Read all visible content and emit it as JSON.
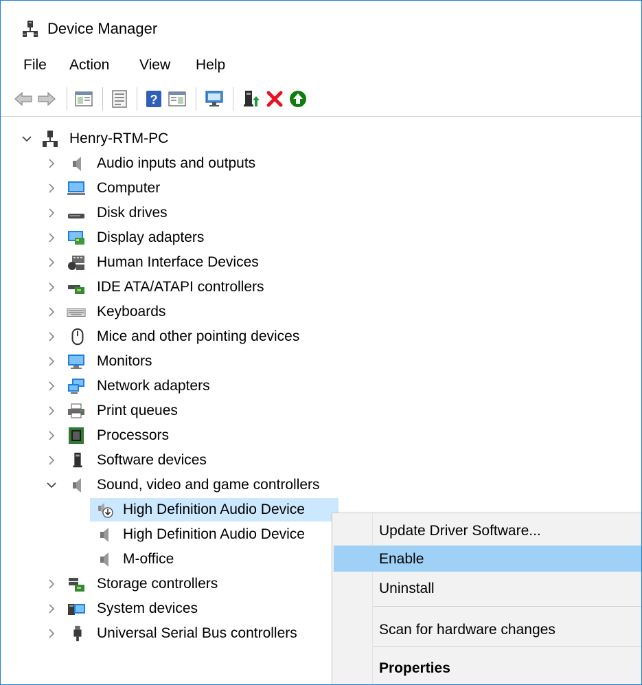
{
  "window": {
    "title": "Device Manager",
    "app_icon": "device-manager-icon"
  },
  "menubar": [
    "File",
    "Action",
    "View",
    "Help"
  ],
  "toolbar": [
    {
      "name": "back-arrow-icon",
      "enabled": false
    },
    {
      "name": "forward-arrow-icon",
      "enabled": false
    },
    {
      "name": "show-hide-console-tree-icon"
    },
    {
      "name": "properties-icon"
    },
    {
      "name": "help-icon"
    },
    {
      "name": "show-action-pane-icon"
    },
    {
      "name": "scan-for-hardware-changes-icon"
    },
    {
      "name": "update-driver-icon"
    },
    {
      "name": "uninstall-device-icon",
      "color": "#e81123"
    },
    {
      "name": "enable-device-icon",
      "color": "#107c10"
    }
  ],
  "tree": {
    "root": {
      "label": "Henry-RTM-PC",
      "icon": "computer-tree-icon",
      "expanded": true
    },
    "categories": [
      {
        "label": "Audio inputs and outputs",
        "icon": "speaker-icon",
        "expanded": false
      },
      {
        "label": "Computer",
        "icon": "monitor-icon",
        "expanded": false
      },
      {
        "label": "Disk drives",
        "icon": "disk-drive-icon",
        "expanded": false
      },
      {
        "label": "Display adapters",
        "icon": "display-adapter-icon",
        "expanded": false
      },
      {
        "label": "Human Interface Devices",
        "icon": "hid-icon",
        "expanded": false
      },
      {
        "label": "IDE ATA/ATAPI controllers",
        "icon": "ide-controller-icon",
        "expanded": false
      },
      {
        "label": "Keyboards",
        "icon": "keyboard-icon",
        "expanded": false
      },
      {
        "label": "Mice and other pointing devices",
        "icon": "mouse-icon",
        "expanded": false
      },
      {
        "label": "Monitors",
        "icon": "monitor-icon",
        "expanded": false
      },
      {
        "label": "Network adapters",
        "icon": "network-adapter-icon",
        "expanded": false
      },
      {
        "label": "Print queues",
        "icon": "printer-icon",
        "expanded": false
      },
      {
        "label": "Processors",
        "icon": "processor-icon",
        "expanded": false
      },
      {
        "label": "Software devices",
        "icon": "software-device-icon",
        "expanded": false
      },
      {
        "label": "Sound, video and game controllers",
        "icon": "speaker-icon",
        "expanded": true,
        "children": [
          {
            "label": "High Definition Audio Device",
            "icon": "disabled-audio-device-icon",
            "selected": true
          },
          {
            "label": "High Definition Audio Device",
            "icon": "speaker-icon",
            "selected": false
          },
          {
            "label": "M-office",
            "icon": "speaker-icon",
            "selected": false
          }
        ]
      },
      {
        "label": "Storage controllers",
        "icon": "storage-controller-icon",
        "expanded": false
      },
      {
        "label": "System devices",
        "icon": "system-devices-icon",
        "expanded": false
      },
      {
        "label": "Universal Serial Bus controllers",
        "icon": "usb-icon",
        "expanded": false
      }
    ]
  },
  "context_menu": {
    "items": [
      {
        "label": "Update Driver Software...",
        "hover": false,
        "bold": false
      },
      {
        "label": "Enable",
        "hover": true,
        "bold": false
      },
      {
        "label": "Uninstall",
        "hover": false,
        "bold": false
      },
      {
        "separator": true
      },
      {
        "label": "Scan for hardware changes",
        "hover": false,
        "bold": false
      },
      {
        "separator": true
      },
      {
        "label": "Properties",
        "hover": false,
        "bold": true
      }
    ]
  },
  "colors": {
    "selection": "#cce8ff",
    "menu_hover": "#9ed1f5",
    "window_border": "#1e7fd0"
  }
}
